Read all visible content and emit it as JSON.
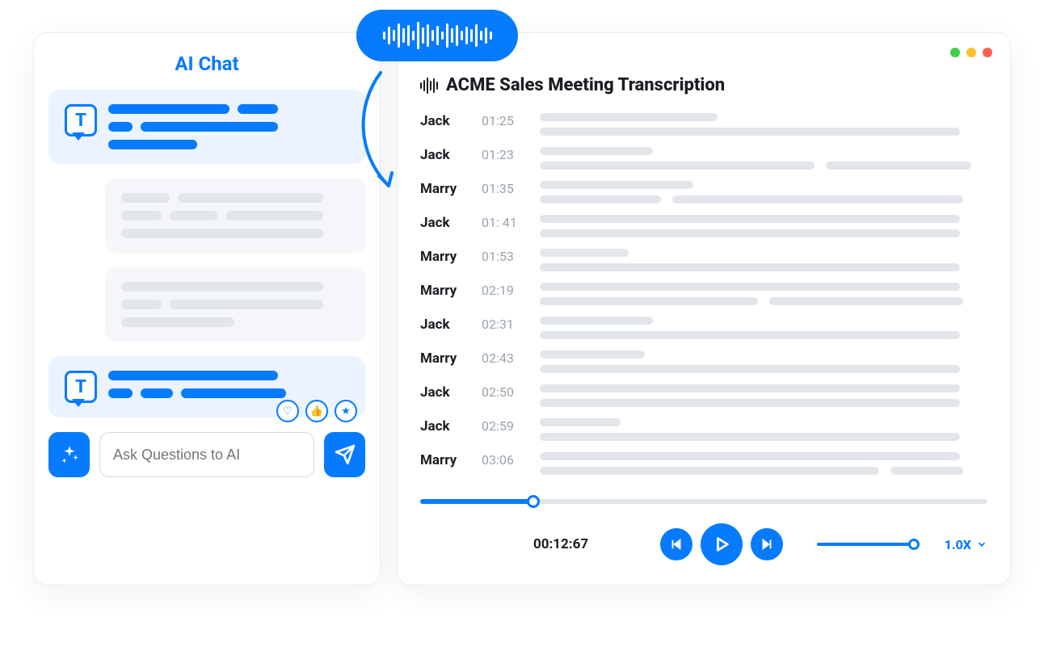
{
  "chat": {
    "title": "AI Chat",
    "input_placeholder": "Ask Questions to AI",
    "avatar_letter": "T"
  },
  "transcription": {
    "title": "ACME Sales Meeting Transcription",
    "rows": [
      {
        "speaker": "Jack",
        "time": "01:25"
      },
      {
        "speaker": "Jack",
        "time": "01:23"
      },
      {
        "speaker": "Marry",
        "time": "01:35"
      },
      {
        "speaker": "Jack",
        "time": "01: 41"
      },
      {
        "speaker": "Marry",
        "time": "01:53"
      },
      {
        "speaker": "Marry",
        "time": "02:19"
      },
      {
        "speaker": "Jack",
        "time": "02:31"
      },
      {
        "speaker": "Marry",
        "time": "02:43"
      },
      {
        "speaker": "Jack",
        "time": "02:50"
      },
      {
        "speaker": "Jack",
        "time": "02:59"
      },
      {
        "speaker": "Marry",
        "time": "03:06"
      }
    ]
  },
  "player": {
    "elapsed": "00:12:67",
    "speed": "1.0X"
  }
}
